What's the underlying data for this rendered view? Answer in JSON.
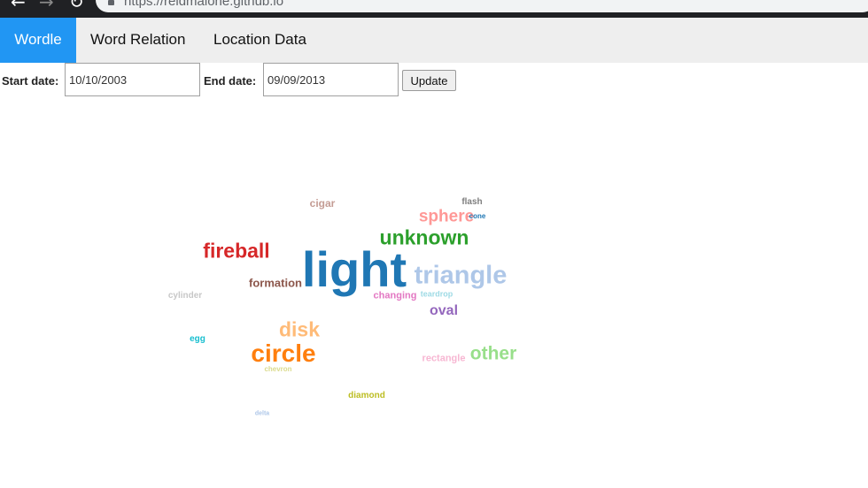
{
  "browser": {
    "url": "https://reidmalone.github.io",
    "back_icon": "←",
    "forward_icon": "→",
    "reload_icon": "↻"
  },
  "nav": {
    "tabs": [
      {
        "label": "Wordle",
        "active": true
      },
      {
        "label": "Word Relation",
        "active": false
      },
      {
        "label": "Location Data",
        "active": false
      }
    ]
  },
  "controls": {
    "start_label": "Start date:",
    "start_value": "10/10/2003",
    "end_label": "End date:",
    "end_value": "09/09/2013",
    "update_label": "Update"
  },
  "wordcloud": {
    "words": [
      {
        "text": "light",
        "color": "#1f77b4"
      },
      {
        "text": "triangle",
        "color": "#aec7e8"
      },
      {
        "text": "unknown",
        "color": "#2ca02c"
      },
      {
        "text": "fireball",
        "color": "#d62728"
      },
      {
        "text": "circle",
        "color": "#ff7f0e"
      },
      {
        "text": "disk",
        "color": "#ffbb78"
      },
      {
        "text": "sphere",
        "color": "#ff9896"
      },
      {
        "text": "other",
        "color": "#98df8a"
      },
      {
        "text": "oval",
        "color": "#9467bd"
      },
      {
        "text": "formation",
        "color": "#8c564b"
      },
      {
        "text": "cigar",
        "color": "#c49c94"
      },
      {
        "text": "flash",
        "color": "#7f7f7f"
      },
      {
        "text": "cone",
        "color": "#1f77b4"
      },
      {
        "text": "changing",
        "color": "#e377c2"
      },
      {
        "text": "teardrop",
        "color": "#9edae5"
      },
      {
        "text": "rectangle",
        "color": "#f7b6d2"
      },
      {
        "text": "cylinder",
        "color": "#c7c7c7"
      },
      {
        "text": "egg",
        "color": "#17becf"
      },
      {
        "text": "chevron",
        "color": "#dbdb8d"
      },
      {
        "text": "diamond",
        "color": "#bcbd22"
      },
      {
        "text": "delta",
        "color": "#aec7e8"
      }
    ]
  }
}
